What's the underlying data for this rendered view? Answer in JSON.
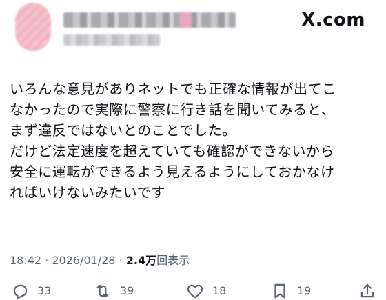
{
  "header": {
    "brand": "X.com"
  },
  "tweet": {
    "lines": [
      "いろんな意見がありネットでも正確な情報が出てこ",
      "なかったので実際に警察に行き話を聞いてみると、",
      "まず違反ではないとのことでした。",
      "だけど法定速度を超えていても確認ができないから",
      "安全に運転ができるよう見えるようにしておかなけ",
      "ればいけないみたいです"
    ]
  },
  "meta": {
    "time": "18:42",
    "separator": "·",
    "date": "2026/01/28",
    "views_count": "2.4万",
    "views_label": "回表示"
  },
  "actions": {
    "replies": "33",
    "reposts": "39",
    "likes": "18",
    "bookmarks": "19"
  },
  "icons": {
    "reply": "reply-icon",
    "repost": "repost-icon",
    "like": "heart-icon",
    "bookmark": "bookmark-icon",
    "share": "share-icon"
  },
  "colors": {
    "text": "#0f1419",
    "muted": "#536471",
    "background": "#ffffff"
  }
}
